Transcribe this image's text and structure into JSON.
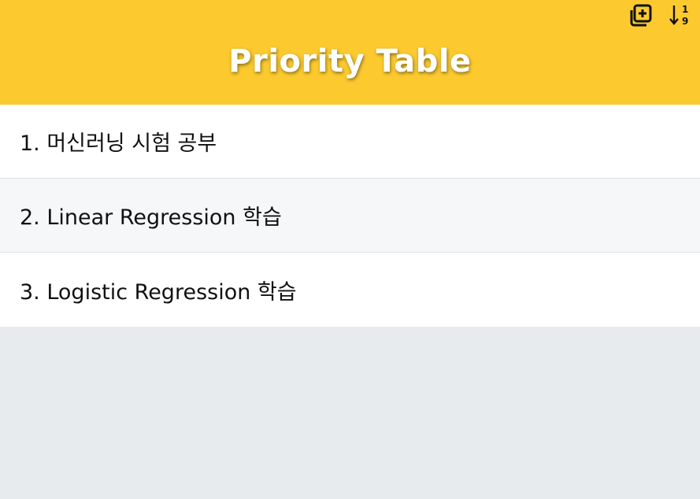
{
  "header": {
    "title": "Priority Table",
    "background_color": "#fcca2f",
    "toolbar": [
      {
        "icon": "add-copy-icon"
      },
      {
        "icon": "sort-numeric-down-icon",
        "digits_top": "1",
        "digits_bottom": "9"
      }
    ]
  },
  "items": [
    {
      "text": "1. 머신러닝 시험 공부"
    },
    {
      "text": "2. Linear Regression 학습"
    },
    {
      "text": "3. Logistic Regression 학습"
    }
  ],
  "page_background": "#e8ebee"
}
